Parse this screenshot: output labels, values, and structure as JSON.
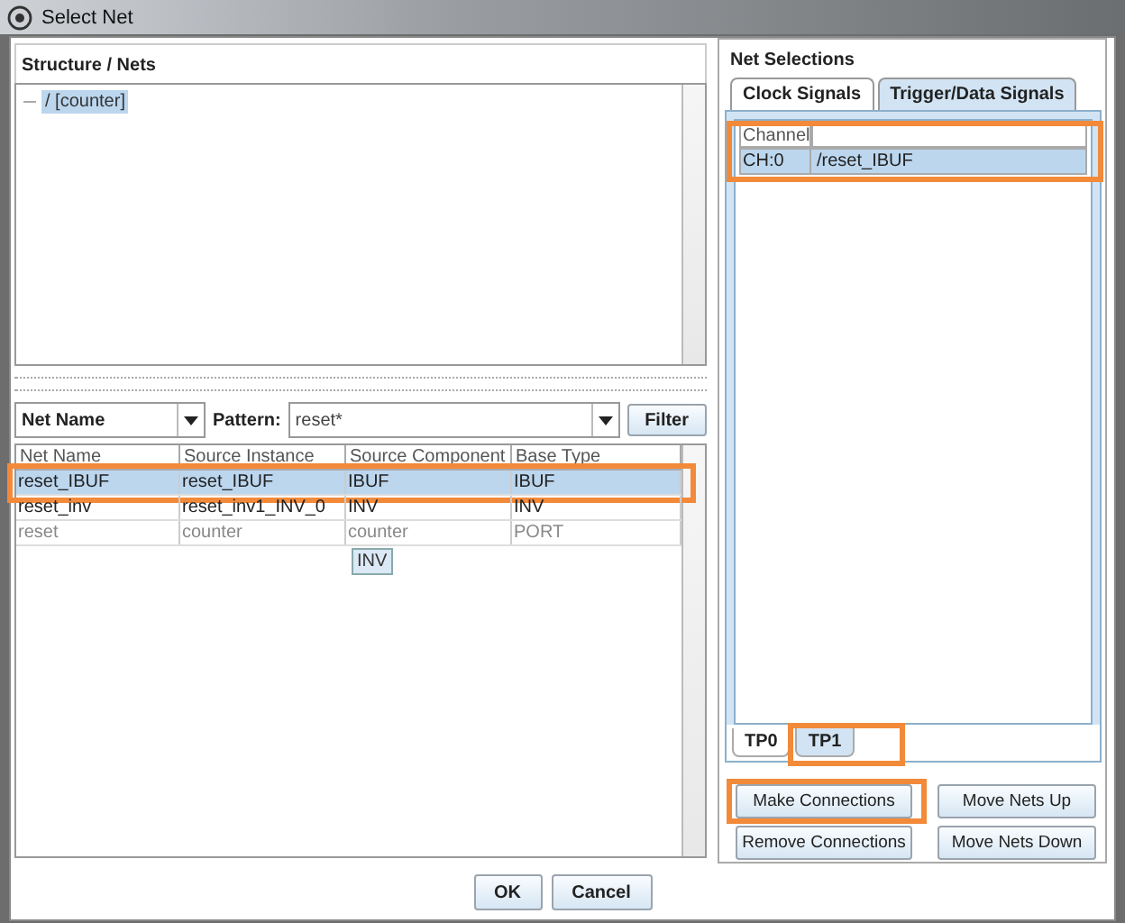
{
  "window": {
    "title": "Select Net"
  },
  "structure": {
    "heading": "Structure / Nets",
    "tree": [
      {
        "label": "/ [counter]",
        "selected": true
      }
    ]
  },
  "filter": {
    "field": "Net Name",
    "pattern_label": "Pattern:",
    "pattern": "reset*",
    "button": "Filter"
  },
  "table": {
    "columns": [
      "Net Name",
      "Source Instance",
      "Source Component",
      "Base Type"
    ],
    "rows": [
      {
        "cells": [
          "reset_IBUF",
          "reset_IBUF",
          "IBUF",
          "IBUF"
        ],
        "selected": true,
        "disabled": false,
        "highlighted": true
      },
      {
        "cells": [
          "reset_inv",
          "reset_inv1_INV_0",
          "INV",
          "INV"
        ],
        "selected": false,
        "disabled": false,
        "highlighted": false
      },
      {
        "cells": [
          "reset",
          "counter",
          "counter",
          "PORT"
        ],
        "selected": false,
        "disabled": true,
        "highlighted": false
      }
    ],
    "tooltip": "INV"
  },
  "net_selections": {
    "heading": "Net Selections",
    "tabs": [
      {
        "label": "Clock Signals",
        "selected": false
      },
      {
        "label": "Trigger/Data Signals",
        "selected": true
      }
    ],
    "columns": [
      "Channel"
    ],
    "channels": [
      {
        "channel": "CH:0",
        "net": "/reset_IBUF",
        "selected": true,
        "highlighted": true
      }
    ],
    "ports": [
      {
        "label": "TP0",
        "selected": false,
        "highlighted": false
      },
      {
        "label": "TP1",
        "selected": true,
        "highlighted": true
      }
    ],
    "buttons": [
      {
        "label": "Make Connections",
        "highlighted": true
      },
      {
        "label": "Move Nets Up",
        "highlighted": false
      },
      {
        "label": "Remove Connections",
        "highlighted": false
      },
      {
        "label": "Move Nets Down",
        "highlighted": false
      }
    ]
  },
  "dialog_buttons": [
    "OK",
    "Cancel"
  ]
}
